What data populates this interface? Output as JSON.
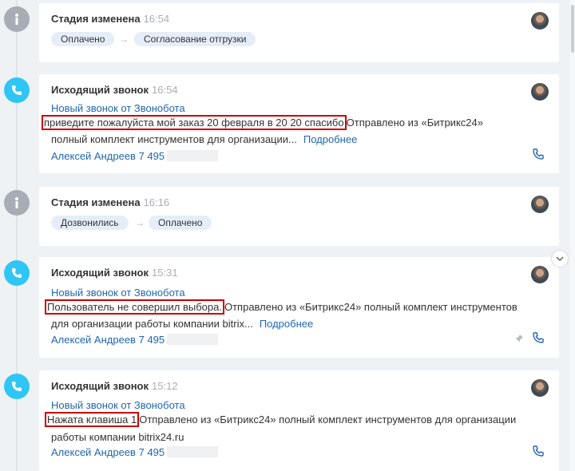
{
  "colors": {
    "accent": "#2fc6f6",
    "link": "#2067b0",
    "info": "#a8adb4",
    "highlight": "#cc0000"
  },
  "entries": [
    {
      "type": "stage",
      "icon": "info-icon",
      "title": "Стадия изменена",
      "time": "16:54",
      "from": "Оплачено",
      "to": "Согласование отгрузки"
    },
    {
      "type": "call",
      "icon": "phone-icon",
      "title": "Исходящий звонок",
      "time": "16:54",
      "subject": "Новый звонок от Звонобота",
      "highlight": "приведите пожалуйста мой заказ 20 февраля в 20 20 спасибо",
      "rest_line1": "Отправлено из «Битрикс24»",
      "line2": "полный комплект инструментов для организации...",
      "more": "Подробнее",
      "author": "Алексей Андреев 7 495"
    },
    {
      "type": "stage",
      "icon": "info-icon",
      "title": "Стадия изменена",
      "time": "16:16",
      "from": "Дозвонились",
      "to": "Оплачено"
    },
    {
      "type": "call",
      "icon": "phone-icon",
      "title": "Исходящий звонок",
      "time": "15:31",
      "subject": "Новый звонок от Звонобота",
      "highlight": "Пользователь не совершил выбора.",
      "rest_line1": "Отправлено из «Битрикс24» полный комплект инструментов",
      "line2": "для организации работы компании bitrix...",
      "more": "Подробнее",
      "author": "Алексей Андреев 7 495"
    },
    {
      "type": "call",
      "icon": "phone-icon",
      "title": "Исходящий звонок",
      "time": "15:12",
      "subject": "Новый звонок от Звонобота",
      "highlight": "Нажата клавиша 1",
      "rest_line1": "Отправлено из «Битрикс24» полный комплект инструментов для организации",
      "line2": "работы компании bitrix24.ru",
      "author": "Алексей Андреев 7 495"
    }
  ]
}
